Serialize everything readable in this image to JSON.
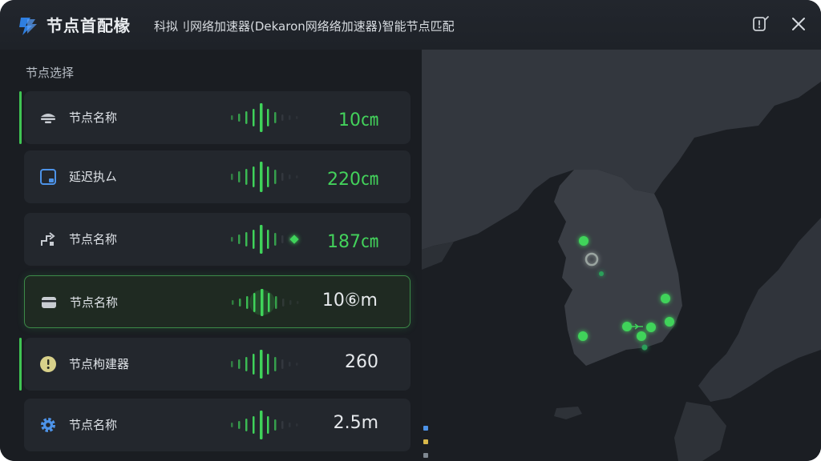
{
  "window": {
    "title": "节点首配椽",
    "subtitle": "科拟刂网络加速器(Dekaron网络络加速器)智能节点匹配"
  },
  "panel": {
    "section_title": "节点选择",
    "nodes": [
      {
        "name": "节点名称",
        "latency": "10㎝",
        "icon": "cloud-icon",
        "active": true,
        "selected": false,
        "latency_color": "#43d15b"
      },
      {
        "name": "延迟执ㄙ",
        "latency": "220㎝",
        "icon": "window-icon",
        "active": false,
        "selected": false,
        "latency_color": "#43d15b"
      },
      {
        "name": "节点名称",
        "latency": "187㎝",
        "icon": "route-icon",
        "active": false,
        "selected": false,
        "latency_color": "#43d15b"
      },
      {
        "name": "节点名称",
        "latency": "10⑥m",
        "icon": "card-icon",
        "active": false,
        "selected": true,
        "latency_color": "#e6e9ec"
      },
      {
        "name": "节点枸建器",
        "latency": "260",
        "icon": "alert-icon",
        "active": true,
        "selected": false,
        "latency_color": "#e6e9ec"
      },
      {
        "name": "节点名称",
        "latency": "2.5m",
        "icon": "gear-icon",
        "active": false,
        "selected": false,
        "latency_color": "#e6e9ec"
      }
    ]
  },
  "colors": {
    "accent_green": "#3fc453",
    "panel_bg": "#1a1d22",
    "row_bg": "#23272d",
    "map_land": "#34383f",
    "map_sea": "#1b1e23"
  }
}
